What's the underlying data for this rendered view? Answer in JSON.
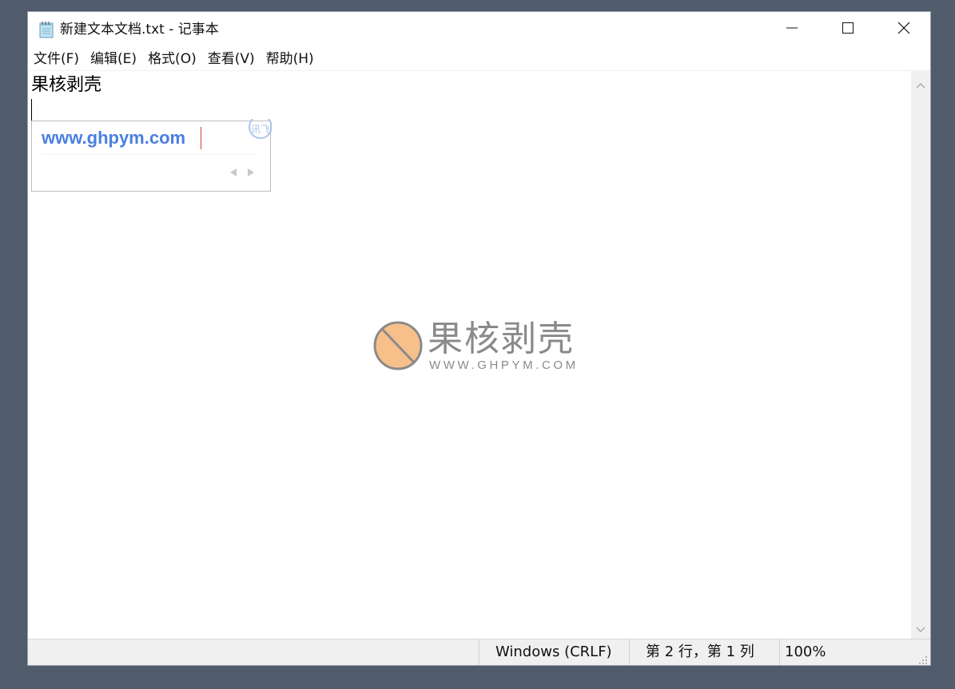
{
  "window": {
    "title": "新建文本文档.txt - 记事本",
    "app_icon": "notepad-icon",
    "controls": {
      "minimize_icon": "minimize-icon",
      "maximize_icon": "maximize-icon",
      "close_icon": "close-icon"
    }
  },
  "menu": {
    "items": [
      {
        "label": "文件(F)"
      },
      {
        "label": "编辑(E)"
      },
      {
        "label": "格式(O)"
      },
      {
        "label": "查看(V)"
      },
      {
        "label": "帮助(H)"
      }
    ]
  },
  "editor": {
    "line1": "果核剥壳",
    "line2": ""
  },
  "ime": {
    "composition": "www.ghpym.com",
    "logo_text": "讯飞",
    "prev_icon": "triangle-left-icon",
    "next_icon": "triangle-right-icon",
    "accent_color": "#4a7fe0"
  },
  "watermark": {
    "title": "果核剥壳",
    "subtitle": "WWW.GHPYM.COM",
    "logo_color": "#f7c08a"
  },
  "statusbar": {
    "encoding": "Windows (CRLF)",
    "position": "第 2 行，第 1 列",
    "zoom": "100%"
  }
}
